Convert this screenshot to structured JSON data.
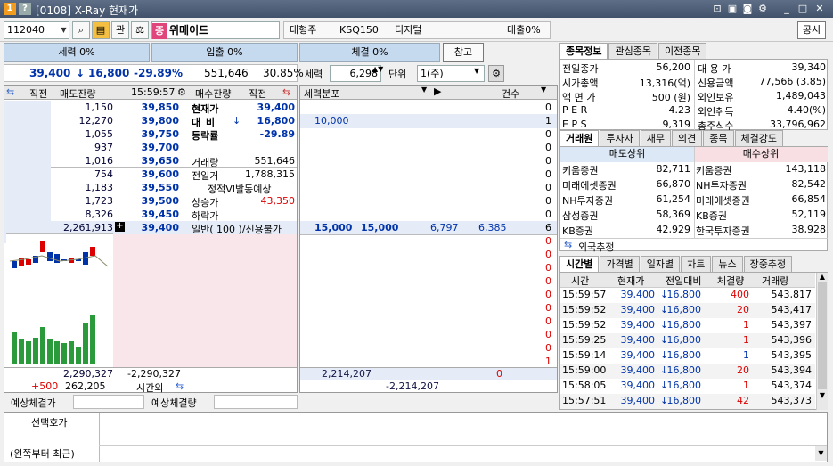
{
  "window": {
    "icon_1": "1",
    "icon_2": "?",
    "title": "[0108] X-Ray 현재가"
  },
  "toolbar": {
    "code": "112040",
    "btn_gwan": "관",
    "badge": "증",
    "stock_name": "위메이드",
    "market_cap_class": "대형주",
    "index": "KSQ150",
    "sector": "디지털",
    "loan_rate": "대출0%",
    "announce_label": "공시"
  },
  "gauges": {
    "force": "세력 0%",
    "inflow": "입출 0%",
    "execution": "체결 0%",
    "reference": "참고"
  },
  "price_bar": {
    "price": "39,400",
    "arrow": "↓",
    "change": "16,800",
    "rate": "-29.89%",
    "volume": "551,646",
    "volume_rate": "30.85%"
  },
  "controls": {
    "force_label": "세력",
    "force_value": "6,298",
    "unit_label": "단위",
    "unit_value": "1(주)"
  },
  "orderbook": {
    "headers": {
      "prev_left": "직전",
      "sell_remain": "매도잔량",
      "time": "15:59:57",
      "buy_remain": "매수잔량",
      "prev_right": "직전"
    },
    "asks": [
      {
        "qty": "1,150",
        "price": "39,850"
      },
      {
        "qty": "12,270",
        "price": "39,800"
      },
      {
        "qty": "1,055",
        "price": "39,750"
      },
      {
        "qty": "937",
        "price": "39,700"
      },
      {
        "qty": "1,016",
        "price": "39,650"
      },
      {
        "qty": "754",
        "price": "39,600"
      },
      {
        "qty": "1,183",
        "price": "39,550"
      },
      {
        "qty": "1,723",
        "price": "39,500"
      },
      {
        "qty": "8,326",
        "price": "39,450"
      },
      {
        "qty": "2,261,913",
        "price": "39,400"
      }
    ],
    "info": [
      {
        "label": "현재가",
        "value": "39,400"
      },
      {
        "label": "대 비",
        "value": "16,800"
      },
      {
        "label": "등락률",
        "value": "-29.89"
      },
      {
        "label": "",
        "value": ""
      },
      {
        "label": "거래량",
        "value": "551,646"
      },
      {
        "label": "전일거",
        "value": "1,788,315"
      },
      {
        "label": "정적VI발동예상",
        "value": ""
      },
      {
        "label": "상승가",
        "value": "43,350"
      },
      {
        "label": "하락가",
        "value": ""
      },
      {
        "label": "일반( 100 )/신용불가",
        "value": ""
      }
    ],
    "total_sell": "2,290,327",
    "total_buy": "-2,290,327",
    "after_change": "+500",
    "after_qty": "262,205",
    "after_label": "시간외",
    "expect_price_label": "예상체결가",
    "expect_qty_label": "예상체결량"
  },
  "trade_panel": {
    "header_left": "세력분포",
    "header_count": "건수",
    "rows": [
      {
        "v1": "",
        "v2": "",
        "v3": "",
        "v4": "",
        "cnt": "0"
      },
      {
        "v1": "10,000",
        "v2": "",
        "v3": "",
        "v4": "",
        "cnt": "1"
      },
      {
        "v1": "",
        "v2": "",
        "v3": "",
        "v4": "",
        "cnt": "0"
      },
      {
        "v1": "",
        "v2": "",
        "v3": "",
        "v4": "",
        "cnt": "0"
      },
      {
        "v1": "",
        "v2": "",
        "v3": "",
        "v4": "",
        "cnt": "0"
      },
      {
        "v1": "",
        "v2": "",
        "v3": "",
        "v4": "",
        "cnt": "0"
      },
      {
        "v1": "",
        "v2": "",
        "v3": "",
        "v4": "",
        "cnt": "0"
      },
      {
        "v1": "",
        "v2": "",
        "v3": "",
        "v4": "",
        "cnt": "0"
      },
      {
        "v1": "",
        "v2": "",
        "v3": "",
        "v4": "",
        "cnt": "0"
      },
      {
        "v1": "15,000",
        "v2": "15,000",
        "v3": "6,797",
        "v4": "6,385",
        "cnt": "6"
      },
      {
        "v1": "",
        "v2": "",
        "v3": "",
        "v4": "",
        "cnt": "0"
      },
      {
        "v1": "",
        "v2": "",
        "v3": "",
        "v4": "",
        "cnt": "0"
      },
      {
        "v1": "",
        "v2": "",
        "v3": "",
        "v4": "",
        "cnt": "0"
      },
      {
        "v1": "",
        "v2": "",
        "v3": "",
        "v4": "",
        "cnt": "0"
      },
      {
        "v1": "",
        "v2": "",
        "v3": "",
        "v4": "",
        "cnt": "0"
      },
      {
        "v1": "",
        "v2": "",
        "v3": "",
        "v4": "",
        "cnt": "0"
      },
      {
        "v1": "",
        "v2": "",
        "v3": "",
        "v4": "",
        "cnt": "0"
      },
      {
        "v1": "",
        "v2": "",
        "v3": "",
        "v4": "",
        "cnt": "0"
      },
      {
        "v1": "",
        "v2": "",
        "v3": "",
        "v4": "",
        "cnt": "0"
      },
      {
        "v1": "",
        "v2": "",
        "v3": "",
        "v4": "",
        "cnt": "1"
      }
    ],
    "total_left": "2,214,207",
    "total_right": "0",
    "total_neg": "-2,214,207"
  },
  "info_tabs": [
    "종목정보",
    "관심종목",
    "이전종목"
  ],
  "info_table": [
    {
      "l1": "전일종가",
      "v1": "56,200",
      "l2": "대 용 가",
      "v2": "39,340"
    },
    {
      "l1": "시가총액",
      "v1": "13,316(억)",
      "l2": "신용금액",
      "v2": "77,566  (3.85)"
    },
    {
      "l1": "액 면 가",
      "v1": "500 (원)",
      "l2": "외인보유",
      "v2": "1,489,043"
    },
    {
      "l1": "P E R",
      "v1": "4.23",
      "l2": "외인취득",
      "v2": "4.40(%)"
    },
    {
      "l1": "E P S",
      "v1": "9,319",
      "l2": "총주식수",
      "v2": "33,796,962"
    }
  ],
  "broker_tabs": [
    "거래원",
    "투자자",
    "재무",
    "의견",
    "종목",
    "체결강도"
  ],
  "brokers": {
    "sell_header": "매도상위",
    "buy_header": "매수상위",
    "rows": [
      {
        "s_name": "키움증권",
        "s_qty": "82,711",
        "b_name": "키움증권",
        "b_qty": "143,118"
      },
      {
        "s_name": "미래에셋증권",
        "s_qty": "66,870",
        "b_name": "NH투자증권",
        "b_qty": "82,542"
      },
      {
        "s_name": "NH투자증권",
        "s_qty": "61,254",
        "b_name": "미래에셋증권",
        "b_qty": "66,854"
      },
      {
        "s_name": "삼성증권",
        "s_qty": "58,369",
        "b_name": "KB증권",
        "b_qty": "52,119"
      },
      {
        "s_name": "KB증권",
        "s_qty": "42,929",
        "b_name": "한국투자증권",
        "b_qty": "38,928"
      }
    ],
    "foreign_label": "외국추정"
  },
  "tick_tabs": [
    "시간별",
    "가격별",
    "일자별",
    "차트",
    "뉴스",
    "장중추정"
  ],
  "ticks": {
    "headers": [
      "시간",
      "현재가",
      "전일대비",
      "체결량",
      "거래량"
    ],
    "rows": [
      {
        "time": "15:59:57",
        "price": "39,400",
        "chg": "16,800",
        "qty": "400",
        "vol": "543,817",
        "qcolor": "red"
      },
      {
        "time": "15:59:52",
        "price": "39,400",
        "chg": "16,800",
        "qty": "20",
        "vol": "543,417",
        "qcolor": "red"
      },
      {
        "time": "15:59:52",
        "price": "39,400",
        "chg": "16,800",
        "qty": "1",
        "vol": "543,397",
        "qcolor": "red"
      },
      {
        "time": "15:59:25",
        "price": "39,400",
        "chg": "16,800",
        "qty": "1",
        "vol": "543,396",
        "qcolor": "red"
      },
      {
        "time": "15:59:14",
        "price": "39,400",
        "chg": "16,800",
        "qty": "1",
        "vol": "543,395",
        "qcolor": "blue"
      },
      {
        "time": "15:59:00",
        "price": "39,400",
        "chg": "16,800",
        "qty": "20",
        "vol": "543,394",
        "qcolor": "red"
      },
      {
        "time": "15:58:05",
        "price": "39,400",
        "chg": "16,800",
        "qty": "1",
        "vol": "543,374",
        "qcolor": "red"
      },
      {
        "time": "15:57:51",
        "price": "39,400",
        "chg": "16,800",
        "qty": "42",
        "vol": "543,373",
        "qcolor": "red"
      }
    ]
  },
  "selection": {
    "label_top": "선택호가",
    "label_bottom": "(왼쪽부터 최근)"
  }
}
